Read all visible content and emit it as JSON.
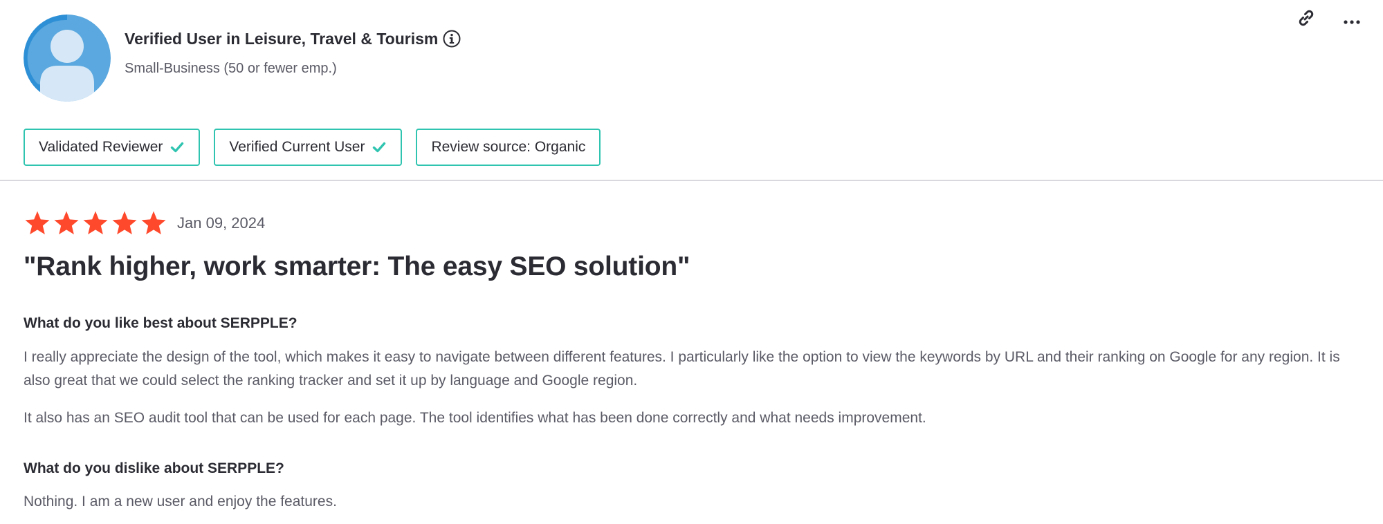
{
  "reviewer": {
    "name": "Verified User in Leisure, Travel & Tourism",
    "company_size": "Small-Business (50 or fewer emp.)",
    "avatar_icon": "default-user-avatar-icon",
    "info_icon": "info-circle-icon"
  },
  "actions": {
    "link_icon": "link-icon",
    "more_icon": "more-horizontal-icon"
  },
  "badges": [
    {
      "label": "Validated Reviewer",
      "icon": "check-icon"
    },
    {
      "label": "Verified Current User",
      "icon": "check-icon"
    },
    {
      "label": "Review source: Organic",
      "icon": ""
    }
  ],
  "review": {
    "rating": 5,
    "rating_max": 5,
    "date": "Jan 09, 2024",
    "title": "\"Rank higher, work smarter: The easy SEO solution\"",
    "sections": [
      {
        "question": "What do you like best about SERPPLE?",
        "paragraphs": [
          "I really appreciate the design of the tool, which makes it easy to navigate between different features. I particularly like the option to view the keywords by URL and their ranking on Google for any region. It is also great that we could select the ranking tracker and set it up by language and Google region.",
          "It also has an SEO audit tool that can be used for each page. The tool identifies what has been done correctly and what needs improvement."
        ]
      },
      {
        "question": "What do you dislike about SERPPLE?",
        "paragraphs": [
          "Nothing. I am a new user and enjoy the features."
        ]
      }
    ]
  },
  "colors": {
    "accent_teal": "#2fc4b0",
    "star_orange": "#ff492c",
    "check_green": "#2fc4b0",
    "text_dark": "#2b2b33",
    "text_muted": "#5a5a66",
    "divider": "#d8d8de",
    "avatar_bg": "#2d8fd5",
    "avatar_fg": "#d6e8f7"
  }
}
